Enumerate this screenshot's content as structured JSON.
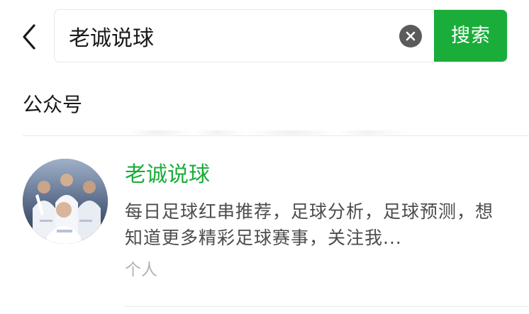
{
  "header": {
    "back_icon": "chevron-left-icon",
    "search_value": "老诚说球",
    "clear_icon": "close-circle-icon",
    "search_button_label": "搜索"
  },
  "section": {
    "title": "公众号"
  },
  "results": [
    {
      "name": "老诚说球",
      "description": "每日足球红串推荐，足球分析，足球预测，想知道更多精彩足球赛事，关注我...",
      "type": "个人",
      "avatar_icon": "football-players-avatar"
    }
  ],
  "colors": {
    "accent_green": "#1aad3a",
    "text_primary": "#191919",
    "text_secondary": "#4c4c4c",
    "text_muted": "#b2b2b2",
    "divider": "#e9e9e9"
  }
}
